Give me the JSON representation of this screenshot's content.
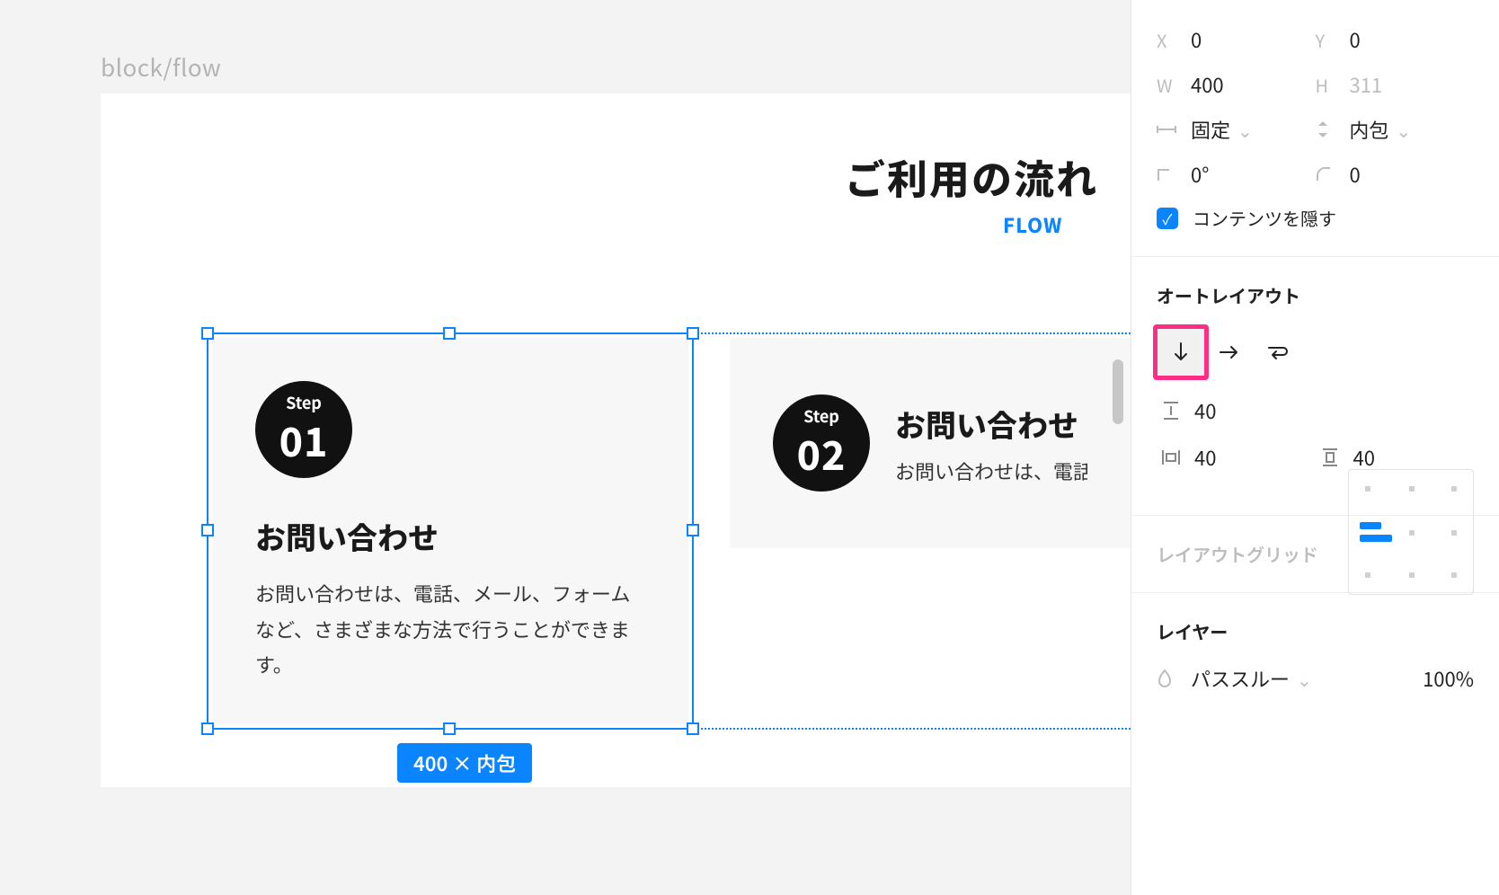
{
  "breadcrumb": "block/flow",
  "artboard": {
    "title": "ご利用の流れ",
    "subtitle": "FLOW"
  },
  "cards": [
    {
      "step_label": "Step",
      "num": "01",
      "title": "お問い合わせ",
      "desc": "お問い合わせは、電話、メール、フォームなど、さまざまな方法で行うことができます。"
    },
    {
      "step_label": "Step",
      "num": "02",
      "title": "お問い合わせ",
      "desc": "お問い合わせは、電話"
    }
  ],
  "selection_badge": "400 × 内包",
  "panel": {
    "x_label": "X",
    "x_val": "0",
    "y_label": "Y",
    "y_val": "0",
    "w_label": "W",
    "w_val": "400",
    "h_label": "H",
    "h_val": "311",
    "width_mode": "固定",
    "height_mode": "内包",
    "rotation": "0°",
    "radius": "0",
    "clip_label": "コンテンツを隠す",
    "al_title": "オートレイアウト",
    "gap": "40",
    "pad_h": "40",
    "pad_v": "40",
    "grid_title": "レイアウトグリッド",
    "layer_title": "レイヤー",
    "blend_mode": "パススルー",
    "opacity": "100%"
  }
}
